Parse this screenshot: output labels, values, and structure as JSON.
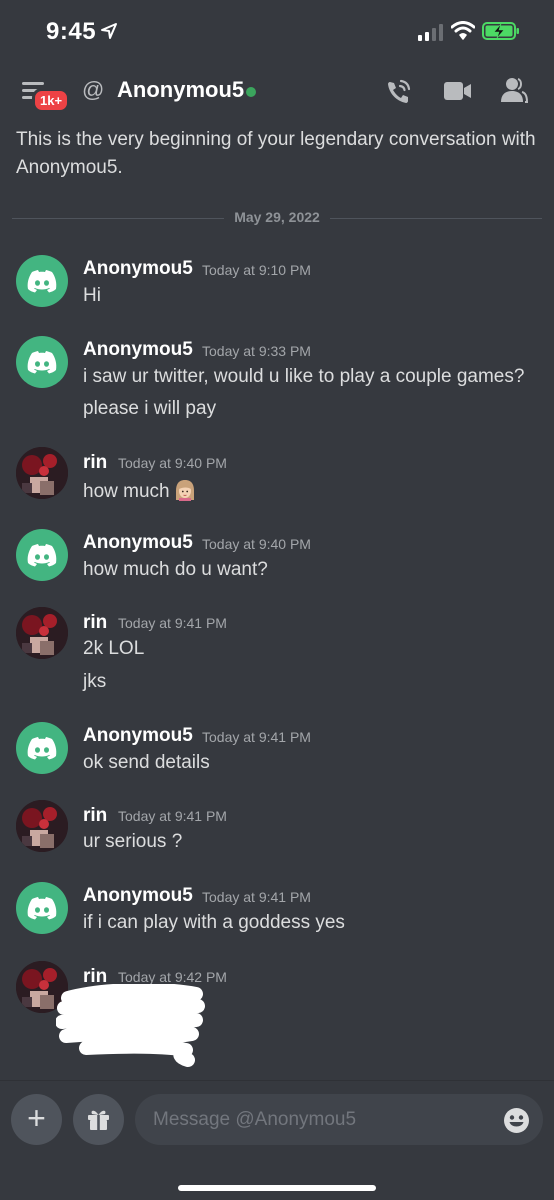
{
  "status_bar": {
    "time": "9:45"
  },
  "header": {
    "badge": "1k+",
    "at_symbol": "@",
    "title": "Anonymou5",
    "online_color": "#3ba55d"
  },
  "intro_text": "This is the very beginning of your legendary conversation with Anonymou5.",
  "date_divider": "May 29, 2022",
  "messages": [
    {
      "author": "Anonymou5",
      "avatar": "discord",
      "time": "Today at 9:10 PM",
      "lines": [
        "Hi"
      ]
    },
    {
      "author": "Anonymou5",
      "avatar": "discord",
      "time": "Today at 9:33 PM",
      "lines": [
        "i saw ur twitter, would u like to play a couple games?",
        "please i will pay"
      ]
    },
    {
      "author": "rin",
      "avatar": "rin",
      "time": "Today at 9:40 PM",
      "lines": [
        "how much"
      ]
    },
    {
      "author": "Anonymou5",
      "avatar": "discord",
      "time": "Today at 9:40 PM",
      "lines": [
        "how much do u want?"
      ]
    },
    {
      "author": "rin",
      "avatar": "rin",
      "time": "Today at 9:41 PM",
      "lines": [
        "2k LOL",
        "jks"
      ]
    },
    {
      "author": "Anonymou5",
      "avatar": "discord",
      "time": "Today at 9:41 PM",
      "lines": [
        "ok send details"
      ]
    },
    {
      "author": "rin",
      "avatar": "rin",
      "time": "Today at 9:41 PM",
      "lines": [
        "ur serious ?"
      ]
    },
    {
      "author": "Anonymou5",
      "avatar": "discord",
      "time": "Today at 9:41 PM",
      "lines": [
        "if i can play with a goddess yes"
      ]
    },
    {
      "author": "rin",
      "avatar": "rin",
      "time": "Today at 9:42 PM",
      "lines": []
    }
  ],
  "composer": {
    "plus_label": "+",
    "placeholder": "Message @Anonymou5"
  },
  "colors": {
    "background": "#36393f",
    "discord_green": "#43b581",
    "badge_red": "#ed4245",
    "input_bg": "#40444b"
  },
  "icons": [
    "location-arrow-icon",
    "signal-icon",
    "wifi-icon",
    "battery-charging-icon",
    "hamburger-menu-icon",
    "call-icon",
    "video-icon",
    "members-icon",
    "gift-icon",
    "emoji-icon",
    "discord-logo-icon"
  ]
}
